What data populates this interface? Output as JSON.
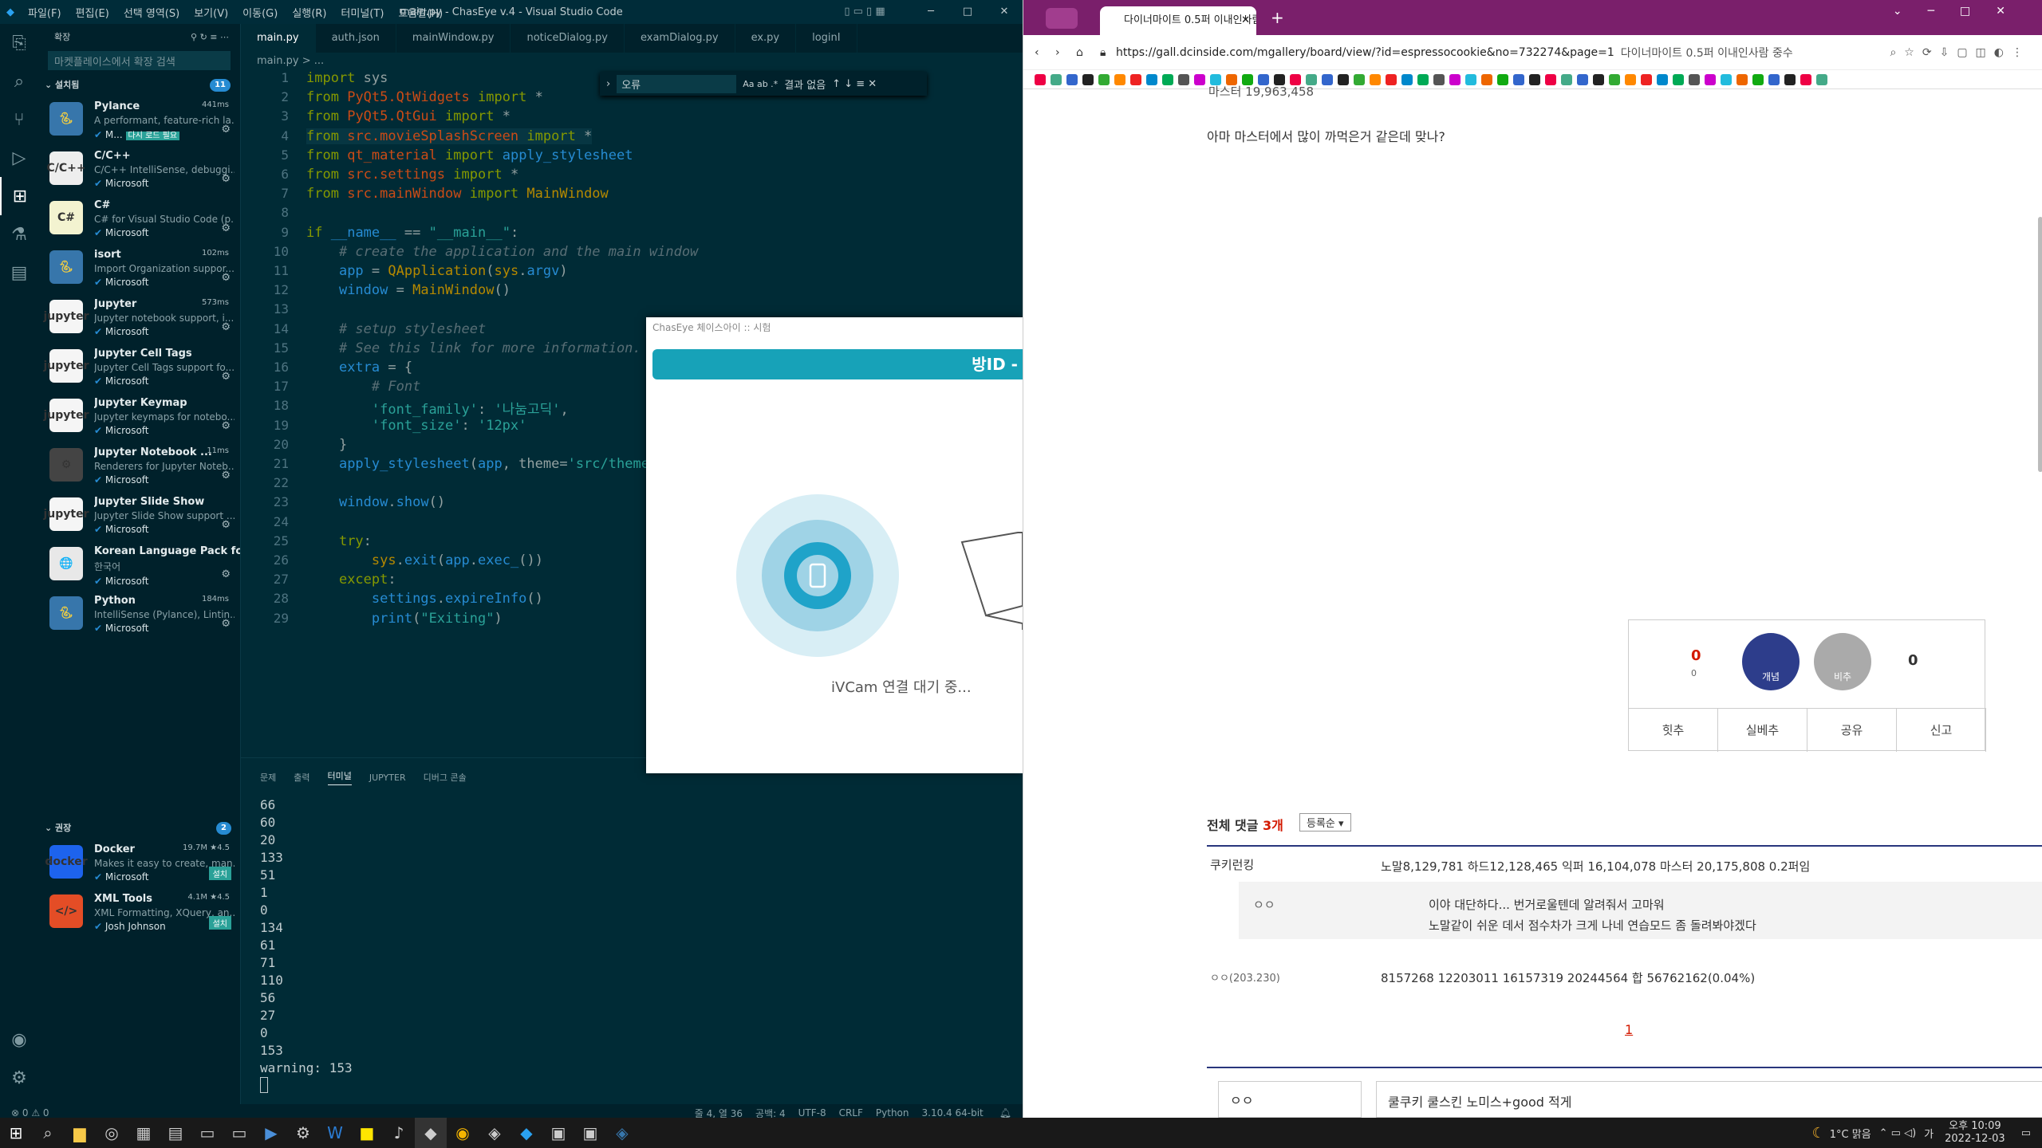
{
  "vscode": {
    "menu": [
      "파일(F)",
      "편집(E)",
      "선택 영역(S)",
      "보기(V)",
      "이동(G)",
      "실행(R)",
      "터미널(T)",
      "도움말(H)"
    ],
    "title": "main.py - ChasEye v.4 - Visual Studio Code",
    "sidebar": {
      "header": "확장",
      "search_placeholder": "마켓플레이스에서 확장 검색",
      "installed_label": "설치됨",
      "installed_count": "11",
      "installed": [
        {
          "name": "Pylance",
          "desc": "A performant, feature-rich la...",
          "pub": "M...",
          "time": "441ms",
          "extra": "다시 로드 필요",
          "icon": "python-icon",
          "color": "#3776ab"
        },
        {
          "name": "C/C++",
          "desc": "C/C++ IntelliSense, debuggi...",
          "pub": "Microsoft",
          "time": "",
          "icon": "cpp-icon",
          "color": "#eee",
          "txt": "C/C++"
        },
        {
          "name": "C#",
          "desc": "C# for Visual Studio Code (p...",
          "pub": "Microsoft",
          "time": "",
          "icon": "csharp-icon",
          "color": "#f3f3d0",
          "txt": "C#"
        },
        {
          "name": "isort",
          "desc": "Import Organization suppor...",
          "pub": "Microsoft",
          "time": "102ms",
          "icon": "python-icon",
          "color": "#3776ab"
        },
        {
          "name": "Jupyter",
          "desc": "Jupyter notebook support, i...",
          "pub": "Microsoft",
          "time": "573ms",
          "icon": "jupyter-icon",
          "color": "#f5f5f5",
          "txt": "jupyter"
        },
        {
          "name": "Jupyter Cell Tags",
          "desc": "Jupyter Cell Tags support fo...",
          "pub": "Microsoft",
          "time": "",
          "icon": "jupyter-icon",
          "color": "#f5f5f5",
          "txt": "jupyter"
        },
        {
          "name": "Jupyter Keymap",
          "desc": "Jupyter keymaps for notebo...",
          "pub": "Microsoft",
          "time": "",
          "icon": "jupyter-icon",
          "color": "#f5f5f5",
          "txt": "jupyter"
        },
        {
          "name": "Jupyter Notebook ...",
          "desc": "Renderers for Jupyter Noteb...",
          "pub": "Microsoft",
          "time": "11ms",
          "icon": "jupyter-icon",
          "color": "#444",
          "txt": "⚙"
        },
        {
          "name": "Jupyter Slide Show",
          "desc": "Jupyter Slide Show support ...",
          "pub": "Microsoft",
          "time": "",
          "icon": "jupyter-icon",
          "color": "#f5f5f5",
          "txt": "jupyter"
        },
        {
          "name": "Korean Language Pack for...",
          "desc": "한국어",
          "pub": "Microsoft",
          "time": "",
          "icon": "globe-icon",
          "color": "#e8e8e8",
          "txt": "🌐"
        },
        {
          "name": "Python",
          "desc": "IntelliSense (Pylance), Lintin...",
          "pub": "Microsoft",
          "time": "184ms",
          "icon": "python-icon",
          "color": "#3776ab"
        }
      ],
      "recommended_label": "권장",
      "recommended_count": "2",
      "recommended": [
        {
          "name": "Docker",
          "desc": "Makes it easy to create, man...",
          "pub": "Microsoft",
          "stats": "19.7M ★4.5",
          "install": "설치",
          "icon": "docker-icon",
          "color": "#1d63ed",
          "txt": "docker"
        },
        {
          "name": "XML Tools",
          "desc": "XML Formatting, XQuery, an...",
          "pub": "Josh Johnson",
          "stats": "4.1M ★4.5",
          "install": "설치",
          "icon": "xml-icon",
          "color": "#e44d26",
          "txt": "</>"
        }
      ]
    },
    "tabs": [
      "main.py",
      "auth.json",
      "mainWindow.py",
      "noticeDialog.py",
      "examDialog.py",
      "ex.py",
      "loginI"
    ],
    "breadcrumb": "main.py > ...",
    "find": {
      "value": "오류",
      "result": "결과 없음"
    },
    "panel_tabs": [
      "문제",
      "출력",
      "터미널",
      "JUPYTER",
      "디버그 콘솔"
    ],
    "terminal": [
      "66",
      "60",
      "20",
      "133",
      "51",
      "1",
      "0",
      "134",
      "61",
      "71",
      "110",
      "56",
      "27",
      "0",
      "153",
      "warning: 153"
    ],
    "status": {
      "errors": "⊗ 0 ⚠ 0",
      "pos": "줄 4, 열 36",
      "spaces": "공백: 4",
      "enc": "UTF-8",
      "eol": "CRLF",
      "lang": "Python",
      "ver": "3.10.4 64-bit"
    }
  },
  "dialog": {
    "title": "ChasEye 체이스아이 :: 시험",
    "room": "방ID -",
    "waiting": "iVCam 연결 대기 중..."
  },
  "chrome": {
    "tab_title": "다이너마이트 0.5퍼 이내인사람",
    "url": "https://gall.dcinside.com/mgallery/board/view/?id=espressocookie&no=732274&page=1",
    "url_suffix": "다이너마이트 0.5퍼 이내인사람 중수",
    "post_top": "마스터 19,963,458",
    "post_body": "아마 마스터에서 많이 까먹은거 같은데 맞나?",
    "vote": {
      "up_count": "0",
      "up_sub": "0",
      "up_label": "개념",
      "down_label": "비추",
      "down_count": "0",
      "actions": [
        "힛추",
        "실베추",
        "공유",
        "신고"
      ]
    },
    "comments_label": "전체 댓글",
    "comments_count": "3개",
    "sort": "등록순",
    "comments": [
      {
        "author": "쿠키런킹",
        "text": "노말8,129,781 하드12,128,465 익퍼 16,104,078 마스터 20,175,808 0.2퍼임"
      },
      {
        "author": "ㅇㅇ",
        "text": "이야 대단하다... 번거로울텐데 알려줘서 고마워",
        "text2": "노말같이 쉬운 데서 점수차가 크게 나네 연습모드 좀 돌려봐야겠다"
      },
      {
        "author": "ㅇㅇ(203.230)",
        "text": "8157268 12203011 16157319 20244564 합 56762162(0.04%)"
      }
    ],
    "page_num": "1",
    "name_input": "ㅇㅇ",
    "reply_text": "쿨쿠키 쿨스킨 노미스+good 적게"
  },
  "taskbar": {
    "weather": "1°C 맑음",
    "time": "오후 10:09",
    "date": "2022-12-03",
    "lang": "가"
  }
}
